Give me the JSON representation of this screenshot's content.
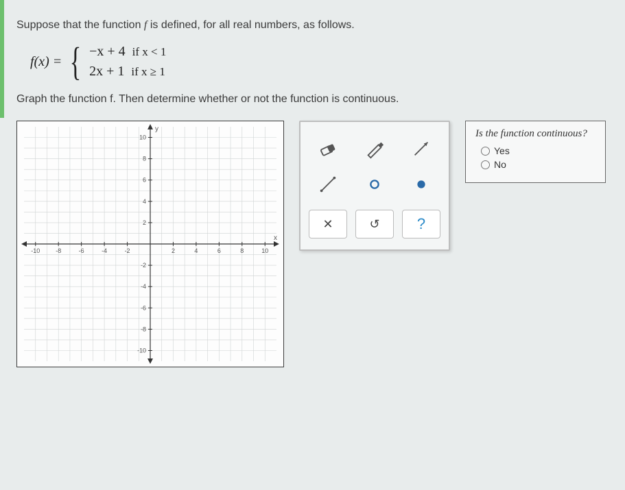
{
  "problem": {
    "intro_prefix": "Suppose that the function ",
    "intro_suffix": " is defined, for all real numbers, as follows.",
    "f_name": "f",
    "fx_lhs": "f(x) =",
    "case1_expr": "−x + 4",
    "case1_cond": "if x < 1",
    "case2_expr": "2x + 1",
    "case2_cond": "if x ≥ 1",
    "instruction_prefix": "Graph the function ",
    "instruction_suffix": ". Then determine whether or not the function is continuous."
  },
  "chart_data": {
    "type": "scatter",
    "title": "",
    "xlabel": "x",
    "ylabel": "y",
    "xlim": [
      -11,
      11
    ],
    "ylim": [
      -11,
      11
    ],
    "x_ticks": [
      -10,
      -8,
      -6,
      -4,
      -2,
      2,
      4,
      6,
      8,
      10
    ],
    "y_ticks": [
      -10,
      -8,
      -6,
      -4,
      -2,
      2,
      4,
      6,
      8,
      10
    ],
    "grid": true,
    "series": []
  },
  "tools": {
    "eraser": "eraser",
    "pencil": "pencil",
    "ray_arrow": "ray-with-arrow",
    "segment": "segment",
    "open_point": "open-point",
    "closed_point": "closed-point"
  },
  "actions": {
    "clear": "✕",
    "undo": "↺",
    "help": "?"
  },
  "question": {
    "prompt": "Is the function continuous?",
    "opt_yes": "Yes",
    "opt_no": "No"
  }
}
